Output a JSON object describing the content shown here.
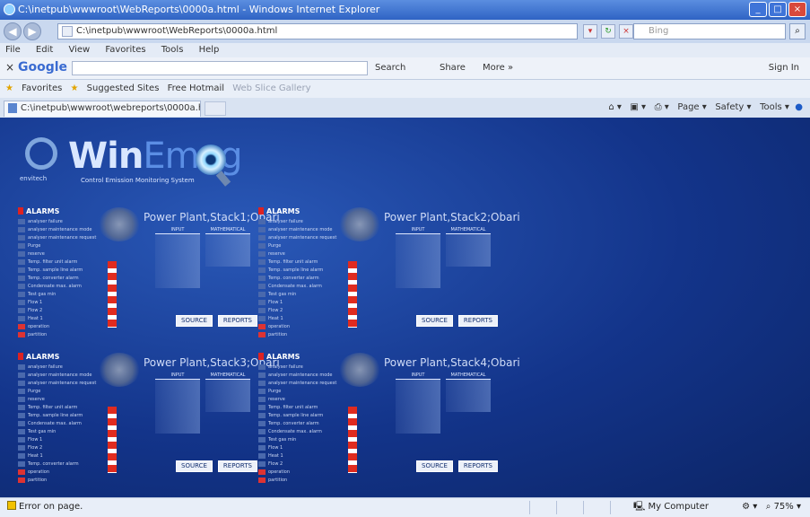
{
  "window": {
    "title": "C:\\inetpub\\wwwroot\\WebReports\\0000a.html - Windows Internet Explorer"
  },
  "address": {
    "url": "C:\\inetpub\\wwwroot\\WebReports\\0000a.html",
    "search_placeholder": "Bing"
  },
  "menu": [
    "File",
    "Edit",
    "View",
    "Favorites",
    "Tools",
    "Help"
  ],
  "google_bar": {
    "logo": "Google",
    "search": "Search",
    "share": "Share",
    "more": "More »",
    "sign_in": "Sign In"
  },
  "favorites_bar": {
    "favorites": "Favorites",
    "suggested": "Suggested Sites",
    "hotmail": "Free Hotmail",
    "gallery": "Web Slice Gallery"
  },
  "tab": {
    "label": "C:\\inetpub\\wwwroot\\webreports\\0000a.html"
  },
  "command_bar": {
    "page": "Page",
    "safety": "Safety",
    "tools": "Tools"
  },
  "logo": {
    "company": "envitech",
    "win": "Win",
    "emag": "Emag",
    "subtitle": "Control Emission Monitoring System"
  },
  "panels": [
    {
      "title": "Power Plant,Stack1;Obari",
      "alarms_label": "ALARMS",
      "alarms": [
        {
          "text": "analyser failure",
          "red": false
        },
        {
          "text": "analyser maintenance mode",
          "red": false
        },
        {
          "text": "analyser maintenance request",
          "red": false
        },
        {
          "text": "Purge",
          "red": false
        },
        {
          "text": "reserve",
          "red": false
        },
        {
          "text": "Temp. filter unit alarm",
          "red": false
        },
        {
          "text": "Temp. sample line alarm",
          "red": false
        },
        {
          "text": "Temp. converter alarm",
          "red": false
        },
        {
          "text": "Condensate max. alarm",
          "red": false
        },
        {
          "text": "Test gas min",
          "red": false
        },
        {
          "text": "Flow 1",
          "red": false
        },
        {
          "text": "Flow 2",
          "red": false
        },
        {
          "text": "Heat 1",
          "red": false
        },
        {
          "text": "operation",
          "red": true
        },
        {
          "text": "partition",
          "red": true
        }
      ],
      "col_headers": [
        "INPUT",
        "MATHEMATICAL"
      ],
      "rows": 10,
      "buttons": [
        "SOURCE",
        "REPORTS"
      ]
    },
    {
      "title": "Power Plant,Stack2;Obari",
      "alarms_label": "ALARMS",
      "alarms": [
        {
          "text": "analyser failure",
          "red": false
        },
        {
          "text": "analyser maintenance mode",
          "red": false
        },
        {
          "text": "analyser maintenance request",
          "red": false
        },
        {
          "text": "Purge",
          "red": false
        },
        {
          "text": "reserve",
          "red": false
        },
        {
          "text": "Temp. filter unit alarm",
          "red": false
        },
        {
          "text": "Temp. sample line alarm",
          "red": false
        },
        {
          "text": "Temp. converter alarm",
          "red": false
        },
        {
          "text": "Condensate max. alarm",
          "red": false
        },
        {
          "text": "Test gas min",
          "red": false
        },
        {
          "text": "Flow 1",
          "red": false
        },
        {
          "text": "Flow 2",
          "red": false
        },
        {
          "text": "Heat 1",
          "red": false
        },
        {
          "text": "operation",
          "red": true
        },
        {
          "text": "partition",
          "red": true
        }
      ],
      "col_headers": [
        "INPUT",
        "MATHEMATICAL"
      ],
      "rows": 10,
      "buttons": [
        "SOURCE",
        "REPORTS"
      ]
    },
    {
      "title": "Power Plant,Stack3;Obari",
      "alarms_label": "ALARMS",
      "alarms": [
        {
          "text": "analyser failure",
          "red": false
        },
        {
          "text": "analyser maintenance mode",
          "red": false
        },
        {
          "text": "analyser maintenance request",
          "red": false
        },
        {
          "text": "Purge",
          "red": false
        },
        {
          "text": "reserve",
          "red": false
        },
        {
          "text": "Temp. filter unit alarm",
          "red": false
        },
        {
          "text": "Temp. sample line alarm",
          "red": false
        },
        {
          "text": "Condensate max. alarm",
          "red": false
        },
        {
          "text": "Test gas min",
          "red": false
        },
        {
          "text": "Flow 1",
          "red": false
        },
        {
          "text": "Flow 2",
          "red": false
        },
        {
          "text": "Heat 1",
          "red": false
        },
        {
          "text": "Temp. converter alarm",
          "red": false
        },
        {
          "text": "operation",
          "red": true
        },
        {
          "text": "partition",
          "red": true
        }
      ],
      "col_headers": [
        "INPUT",
        "MATHEMATICAL"
      ],
      "rows": 10,
      "buttons": [
        "SOURCE",
        "REPORTS"
      ]
    },
    {
      "title": "Power Plant,Stack4;Obari",
      "alarms_label": "ALARMS",
      "alarms": [
        {
          "text": "analyser failure",
          "red": false
        },
        {
          "text": "analyser maintenance mode",
          "red": false
        },
        {
          "text": "analyser maintenance request",
          "red": false
        },
        {
          "text": "Purge",
          "red": false
        },
        {
          "text": "reserve",
          "red": false
        },
        {
          "text": "Temp. filter unit alarm",
          "red": false
        },
        {
          "text": "Temp. sample line alarm",
          "red": false
        },
        {
          "text": "Temp. converter alarm",
          "red": false
        },
        {
          "text": "Condensate max. alarm",
          "red": false
        },
        {
          "text": "Test gas min",
          "red": false
        },
        {
          "text": "Flow 1",
          "red": false
        },
        {
          "text": "Heat 1",
          "red": false
        },
        {
          "text": "Flow 2",
          "red": false
        },
        {
          "text": "operation",
          "red": true
        },
        {
          "text": "partition",
          "red": true
        }
      ],
      "col_headers": [
        "INPUT",
        "MATHEMATICAL"
      ],
      "rows": 10,
      "buttons": [
        "SOURCE",
        "REPORTS"
      ]
    }
  ],
  "status": {
    "error": "Error on page.",
    "zone": "My Computer",
    "zoom": "75%"
  },
  "colors": {
    "background": "#13348a",
    "alarm_red": "#d33333",
    "chimney_red": "#e02b1f"
  }
}
